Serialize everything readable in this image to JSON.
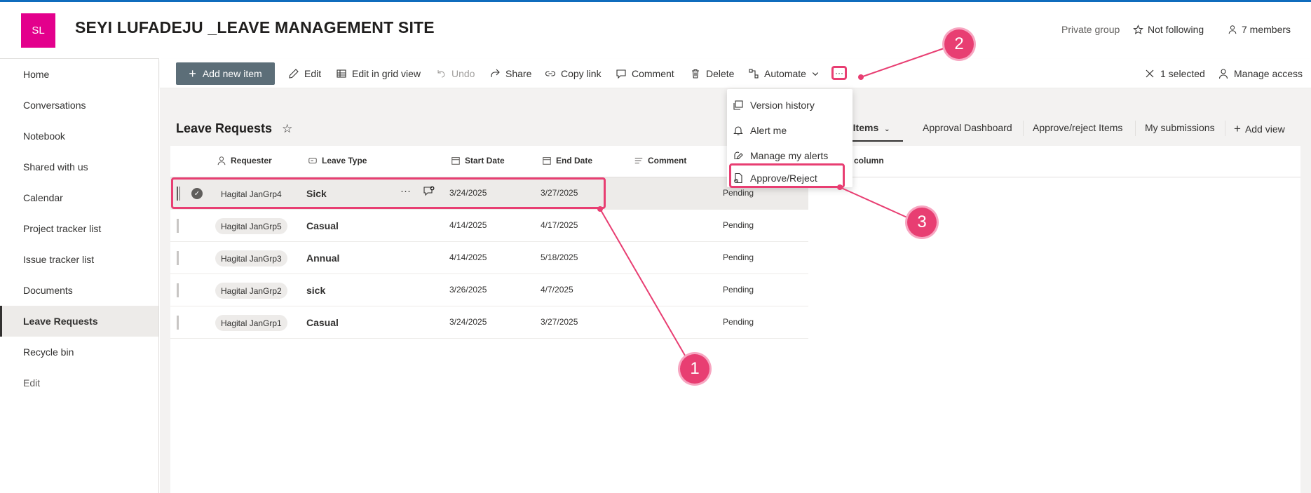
{
  "site": {
    "logo_initials": "SL",
    "title": "SEYI LUFADEJU _LEAVE MANAGEMENT SITE",
    "privacy": "Private group",
    "follow_label": "Not following",
    "members_label": "7 members"
  },
  "nav": {
    "items": [
      {
        "label": "Home"
      },
      {
        "label": "Conversations"
      },
      {
        "label": "Notebook"
      },
      {
        "label": "Shared with us"
      },
      {
        "label": "Calendar"
      },
      {
        "label": "Project tracker list"
      },
      {
        "label": "Issue tracker list"
      },
      {
        "label": "Documents"
      },
      {
        "label": "Leave Requests"
      },
      {
        "label": "Recycle bin"
      },
      {
        "label": "Edit"
      }
    ]
  },
  "toolbar": {
    "add_new_item": "Add new item",
    "edit": "Edit",
    "edit_grid": "Edit in grid view",
    "undo": "Undo",
    "share": "Share",
    "copy_link": "Copy link",
    "comment": "Comment",
    "delete": "Delete",
    "automate": "Automate",
    "more": "···",
    "selected": "1 selected",
    "manage_access": "Manage access"
  },
  "menu": {
    "items": [
      {
        "label": "Version history"
      },
      {
        "label": "Alert me"
      },
      {
        "label": "Manage my alerts"
      },
      {
        "label": "Approve/Reject"
      }
    ]
  },
  "list": {
    "title": "Leave Requests",
    "views": {
      "all_items": "ll Items",
      "approval_dashboard": "Approval Dashboard",
      "approve_reject_items": "Approve/reject Items",
      "my_submissions": "My submissions",
      "add_view": "Add view"
    },
    "columns": {
      "requester": "Requester",
      "leave_type": "Leave Type",
      "start_date": "Start Date",
      "end_date": "End Date",
      "comment": "Comment",
      "add_column": "column"
    },
    "rows": [
      {
        "requester": "Hagital JanGrp4",
        "type": "Sick",
        "start": "3/24/2025",
        "end": "3/27/2025",
        "status": "Pending"
      },
      {
        "requester": "Hagital JanGrp5",
        "type": "Casual",
        "start": "4/14/2025",
        "end": "4/17/2025",
        "status": "Pending"
      },
      {
        "requester": "Hagital JanGrp3",
        "type": "Annual",
        "start": "4/14/2025",
        "end": "5/18/2025",
        "status": "Pending"
      },
      {
        "requester": "Hagital JanGrp2",
        "type": "sick",
        "start": "3/26/2025",
        "end": "4/7/2025",
        "status": "Pending"
      },
      {
        "requester": "Hagital JanGrp1",
        "type": "Casual",
        "start": "3/24/2025",
        "end": "3/27/2025",
        "status": "Pending"
      }
    ],
    "selected_row_more": "···"
  },
  "annotations": {
    "badge_1": "1",
    "badge_2": "2",
    "badge_3": "3",
    "color": "#e83e72"
  },
  "colors": {
    "logo": "#e3008c",
    "primary_button": "#5c6e78",
    "accent": "#0f6cbd"
  }
}
